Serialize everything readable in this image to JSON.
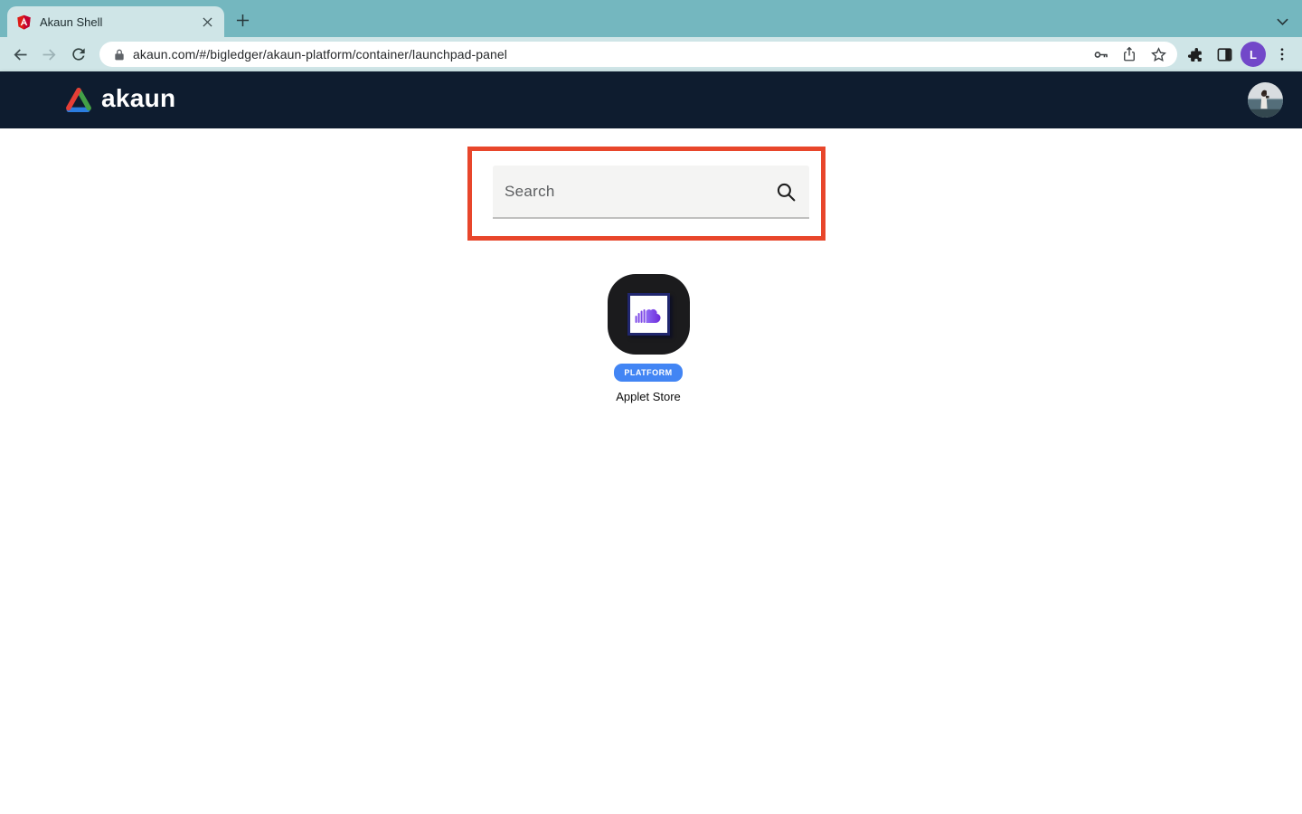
{
  "browser": {
    "tab": {
      "title": "Akaun Shell"
    },
    "url": "akaun.com/#/bigledger/akaun-platform/container/launchpad-panel",
    "profile_initial": "L"
  },
  "header": {
    "logo_text": "akaun"
  },
  "main": {
    "search": {
      "placeholder": "Search"
    },
    "applet": {
      "badge": "PLATFORM",
      "name": "Applet Store"
    }
  },
  "colors": {
    "tabstrip": "#74b7bf",
    "toolbar": "#cfe5e7",
    "navy": "#0e1c2f",
    "accent": "#e8462b",
    "badge-blue": "#4285f4",
    "avatar-purple": "#7248c9",
    "search-bg": "#f4f4f3"
  }
}
